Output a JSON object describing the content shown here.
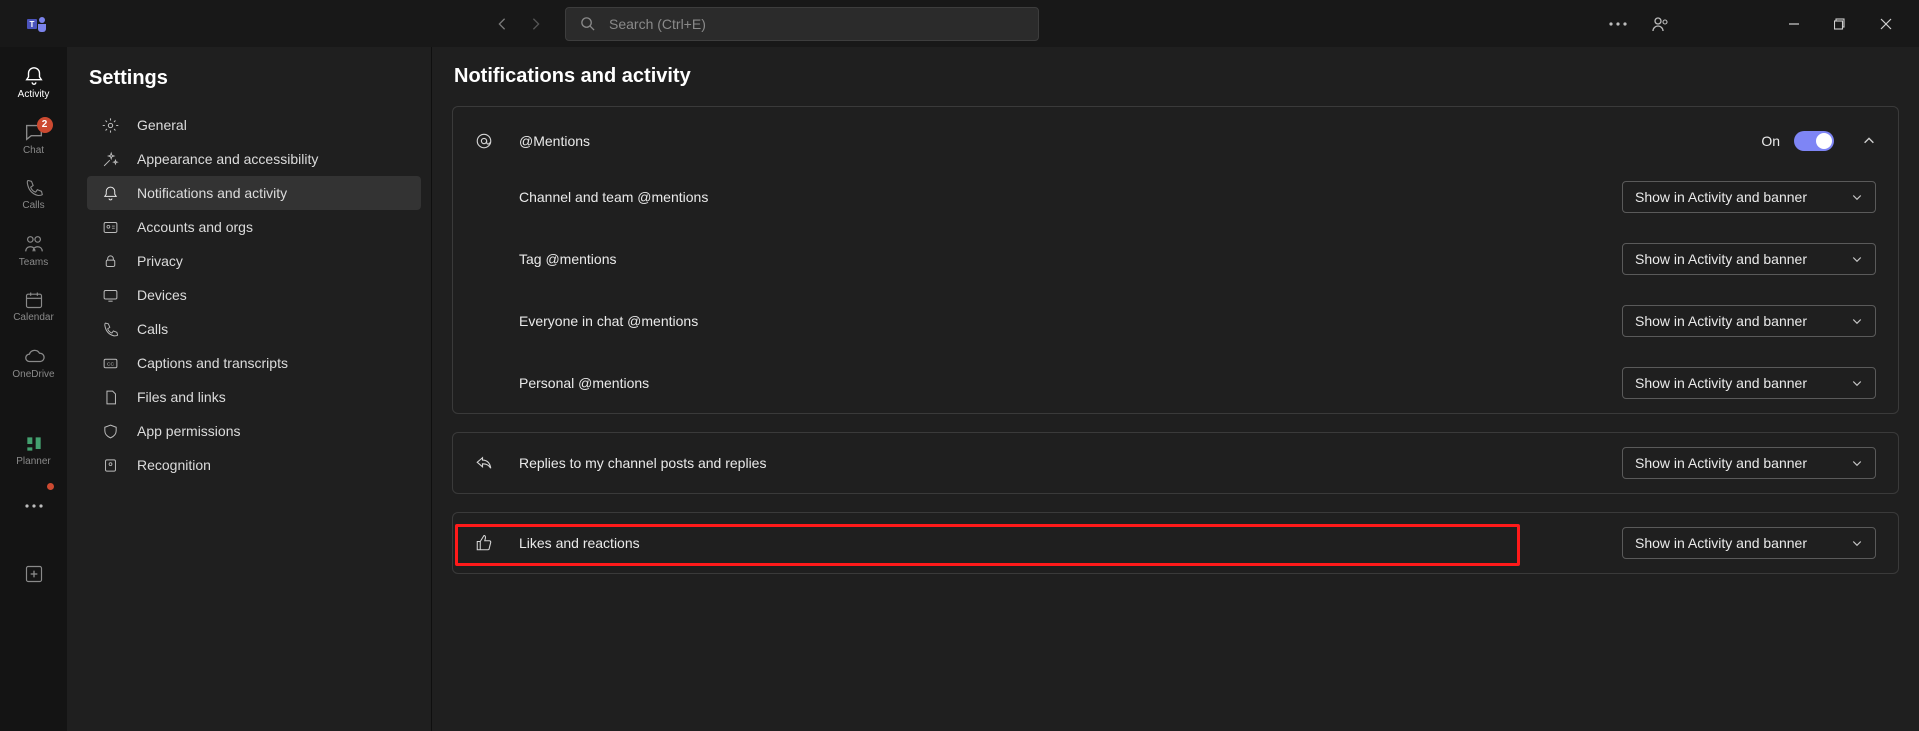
{
  "titlebar": {
    "search_placeholder": "Search (Ctrl+E)"
  },
  "rail": {
    "activity": "Activity",
    "chat": "Chat",
    "chat_badge": "2",
    "calls": "Calls",
    "teams": "Teams",
    "calendar": "Calendar",
    "onedrive": "OneDrive",
    "planner": "Planner"
  },
  "settings": {
    "title": "Settings",
    "items": {
      "general": "General",
      "appearance": "Appearance and accessibility",
      "notifications": "Notifications and activity",
      "accounts": "Accounts and orgs",
      "privacy": "Privacy",
      "devices": "Devices",
      "calls": "Calls",
      "captions": "Captions and transcripts",
      "files": "Files and links",
      "app_permissions": "App permissions",
      "recognition": "Recognition"
    }
  },
  "content": {
    "title": "Notifications and activity",
    "mentions_group": {
      "label": "@Mentions",
      "toggle_text": "On",
      "rows": {
        "channel_team": "Channel and team @mentions",
        "tag": "Tag @mentions",
        "everyone": "Everyone in chat @mentions",
        "personal": "Personal @mentions"
      }
    },
    "replies_group": {
      "label": "Replies to my channel posts and replies"
    },
    "likes_group": {
      "label": "Likes and reactions"
    },
    "select_value": "Show in Activity and banner"
  }
}
